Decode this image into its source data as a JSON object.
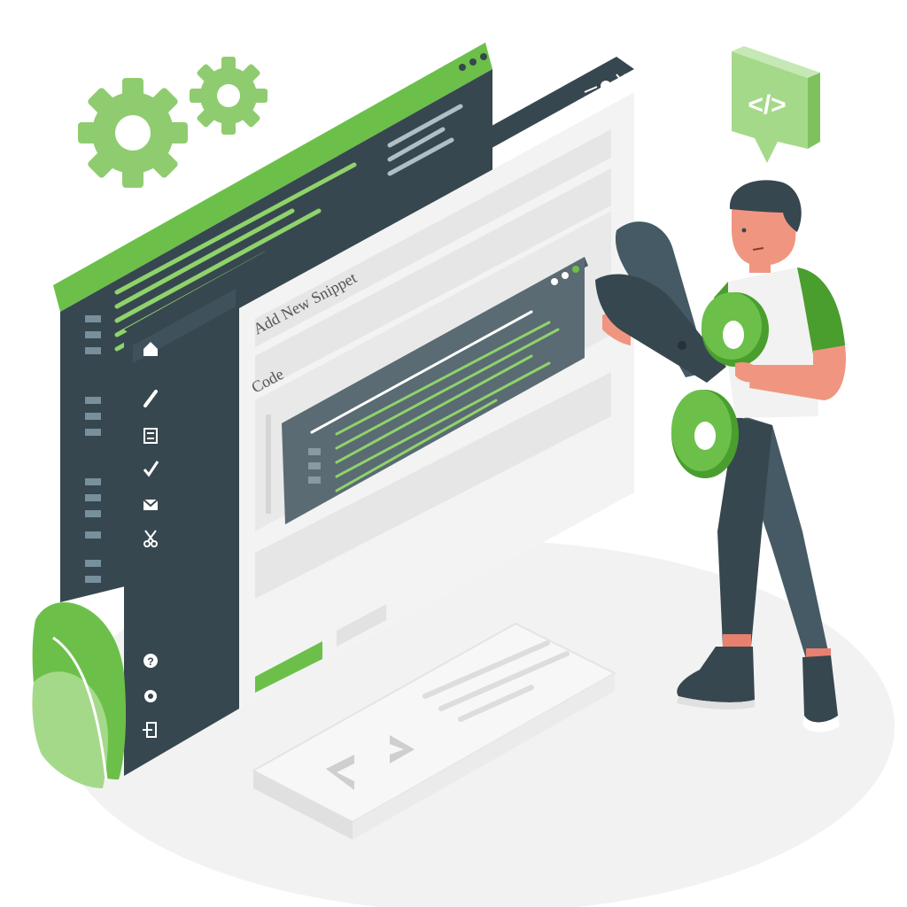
{
  "snippet_form": {
    "title": "Add New Snippet",
    "code_label": "Code"
  },
  "code_badge": {
    "text": "</>"
  },
  "sidebar": {
    "items": [
      {
        "icon": "home-icon"
      },
      {
        "icon": "pencil-icon"
      },
      {
        "icon": "calculator-icon"
      },
      {
        "icon": "check-icon"
      },
      {
        "icon": "mail-icon"
      },
      {
        "icon": "scissors-icon"
      },
      {
        "icon": "help-icon"
      },
      {
        "icon": "gear-icon"
      },
      {
        "icon": "logout-icon"
      }
    ]
  },
  "colors": {
    "accent": "#6cc04a",
    "accent_dark": "#4a9e2e",
    "dark_panel": "#37474f",
    "light_panel": "#f0f0f0"
  }
}
